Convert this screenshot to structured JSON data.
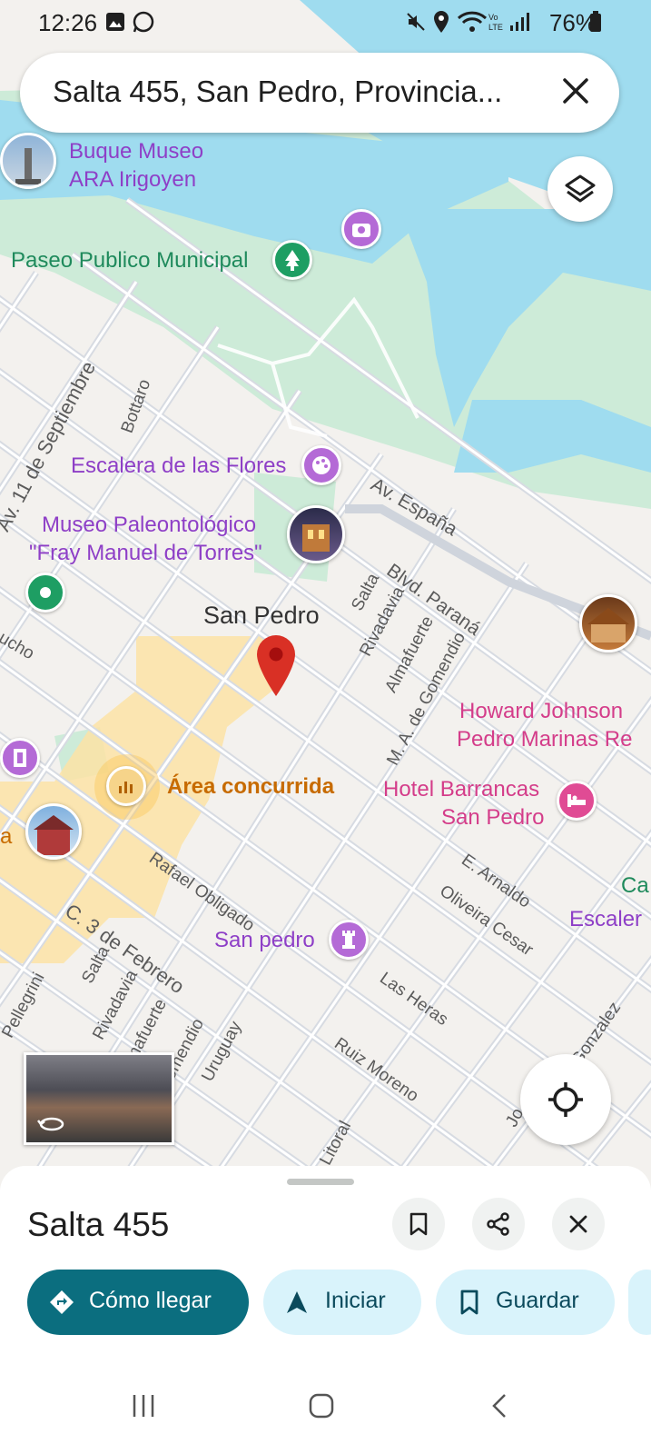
{
  "status_bar": {
    "time": "12:26",
    "battery": "76%"
  },
  "search": {
    "query": "Salta 455, San Pedro, Provincia..."
  },
  "map": {
    "places": {
      "buque": [
        "Buque Museo",
        "ARA Irigoyen"
      ],
      "paseo": "Paseo Publico Municipal",
      "escalera": "Escalera de las Flores",
      "museo": [
        "Museo Paleontológico",
        "\"Fray Manuel de Torres\""
      ],
      "town": "San Pedro",
      "howard": [
        "Howard Johnson",
        "Pedro Marinas Re"
      ],
      "hotel": [
        "Hotel Barrancas",
        "San Pedro"
      ],
      "busy": "Área concurrida",
      "sanpedro2": "San pedro",
      "escalera2": "Escaler",
      "c_cut": "Ca",
      "a_cut": "a"
    },
    "streets": {
      "septiembre": "Av. 11 de Septiembre",
      "bottaro": "Bottaro",
      "espana": "Av. España",
      "salta1": "Salta",
      "blvd": "Blvd. Paraná",
      "rivadavia1": "Rivadavia",
      "almafuerte1": "Almafuerte",
      "gomendio1": "M. A. de Gomendio",
      "arnaldo": "E. Arnaldo",
      "oliveira": "Oliveira Cesar",
      "obligado": "Rafael Obligado",
      "febrero": "C. 3 de Febrero",
      "pellegrini": "Pellegrini",
      "salta2": "Salta",
      "rivadavia2": "Rivadavia",
      "almafuerte2": "lmafuerte",
      "gomendio2": "omendio",
      "uruguay": "Uruguay",
      "lasheras": "Las Heras",
      "ruiz": "Ruiz Moreno",
      "litoral": "Litoral",
      "gonzalez": "Gonzalez",
      "jo": "Jo",
      "ucho": "ucho"
    }
  },
  "sheet": {
    "title": "Salta 455",
    "actions": [
      {
        "label": "Cómo llegar",
        "icon": "directions-icon"
      },
      {
        "label": "Iniciar",
        "icon": "navigation-arrow-icon"
      },
      {
        "label": "Guardar",
        "icon": "bookmark-icon"
      }
    ]
  },
  "colors": {
    "water": "#9fdcef",
    "park": "#cdebd8",
    "busy_area": "#fbe3a6",
    "accent": "#0b6e7f",
    "pin_red": "#d93025"
  }
}
